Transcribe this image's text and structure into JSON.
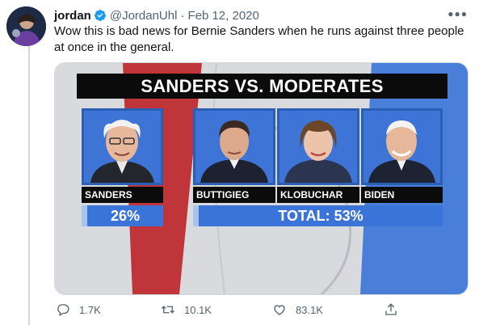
{
  "tweet": {
    "author_name": "jordan",
    "handle": "@JordanUhl",
    "separator": "·",
    "date": "Feb 12, 2020",
    "text": "Wow this is bad news for Bernie Sanders when he runs against three people at once in the general."
  },
  "media": {
    "title": "SANDERS VS. MODERATES",
    "candidates": [
      {
        "name": "SANDERS"
      },
      {
        "name": "BUTTIGIEG"
      },
      {
        "name": "KLOBUCHAR"
      },
      {
        "name": "BIDEN"
      }
    ],
    "sanders_pct": "26%",
    "moderates_total": "TOTAL: 53%"
  },
  "actions": {
    "reply_count": "1.7K",
    "retweet_count": "10.1K",
    "like_count": "83.1K"
  },
  "colors": {
    "accent_blue": "#1d9bf0",
    "bar_blue": "#3b74d8",
    "stripe_red": "#c0353a"
  },
  "icons": [
    "verified-icon",
    "more-icon",
    "reply-icon",
    "retweet-icon",
    "like-icon",
    "share-icon"
  ]
}
